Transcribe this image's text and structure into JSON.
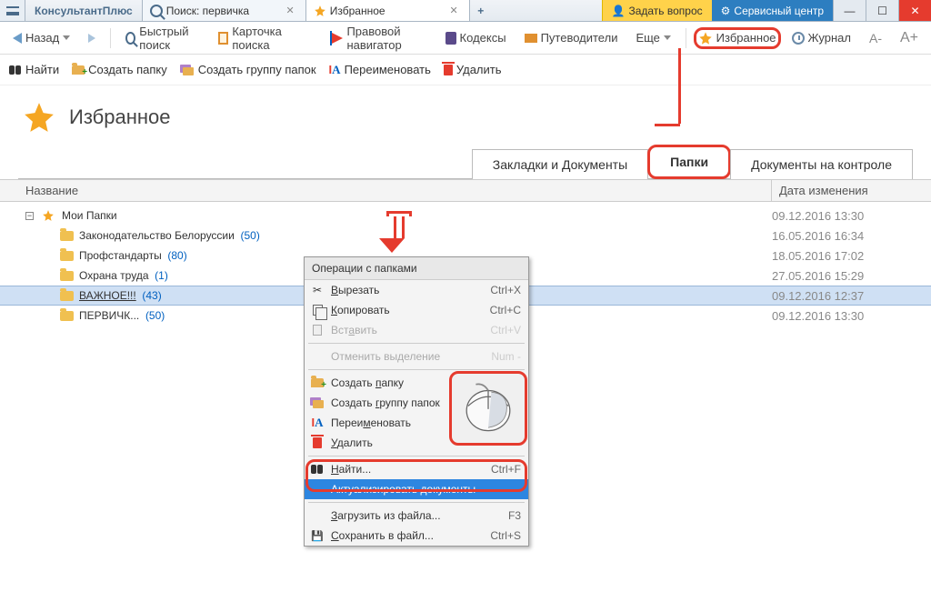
{
  "titlebar": {
    "logo": "КонсультантПлюс",
    "tab_search_label": "Поиск: первичка",
    "tab_fav_label": "Избранное",
    "ask_label": "Задать вопрос",
    "service_label": "Сервисный центр"
  },
  "toolbar": {
    "back": "Назад",
    "quick_search": "Быстрый поиск",
    "card_search": "Карточка поиска",
    "nav": "Правовой навигатор",
    "codex": "Кодексы",
    "guides": "Путеводители",
    "more": "Еще",
    "favorites": "Избранное",
    "journal": "Журнал",
    "font_minus": "A-",
    "font_plus": "A+"
  },
  "sec_toolbar": {
    "find": "Найти",
    "create_folder": "Создать папку",
    "create_group": "Создать группу папок",
    "rename": "Переименовать",
    "delete": "Удалить"
  },
  "page": {
    "title": "Избранное",
    "tabs": {
      "bookmarks": "Закладки и Документы",
      "folders": "Папки",
      "control": "Документы на контроле"
    },
    "th_name": "Название",
    "th_date": "Дата изменения"
  },
  "tree": {
    "root": "Мои Папки",
    "root_date": "09.12.2016 13:30",
    "items": [
      {
        "label": "Законодательство Белоруссии",
        "count": "(50)",
        "date": "16.05.2016 16:34"
      },
      {
        "label": "Профстандарты",
        "count": "(80)",
        "date": "18.05.2016 17:02"
      },
      {
        "label": "Охрана труда",
        "count": "(1)",
        "date": "27.05.2016 15:29"
      },
      {
        "label": "ВАЖНОЕ!!!",
        "count": "(43)",
        "date": "09.12.2016 12:37"
      },
      {
        "label": "ПЕРВИЧК...",
        "count": "(50)",
        "date": "09.12.2016 13:30"
      }
    ]
  },
  "context_menu": {
    "title": "Операции с папками",
    "cut": "Вырезать",
    "cut_sc": "Ctrl+X",
    "copy": "Копировать",
    "copy_sc": "Ctrl+C",
    "paste": "Вставить",
    "paste_sc": "Ctrl+V",
    "deselect": "Отменить выделение",
    "deselect_sc": "Num -",
    "create_folder": "Создать папку",
    "create_group": "Создать группу папок",
    "rename": "Переименовать",
    "delete": "Удалить",
    "find": "Найти...",
    "find_sc": "Ctrl+F",
    "actualize": "Актуализировать документы",
    "load": "Загрузить из файла...",
    "load_sc": "F3",
    "save": "Сохранить в файл...",
    "save_sc": "Ctrl+S"
  }
}
